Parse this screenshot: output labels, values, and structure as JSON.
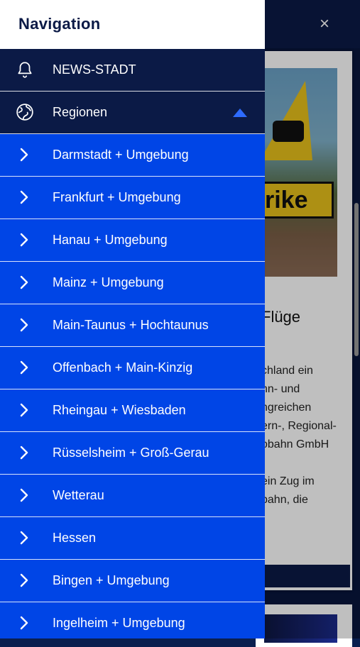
{
  "drawer": {
    "title": "Navigation",
    "top_items": [
      {
        "label": "NEWS-STADT",
        "icon": "bell-icon"
      },
      {
        "label": "Regionen",
        "icon": "globe-icon",
        "expanded": true
      }
    ],
    "regions": [
      "Darmstadt + Umgebung",
      "Frankfurt + Umgebung",
      "Hanau + Umgebung",
      "Mainz + Umgebung",
      "Main-Taunus + Hochtaunus",
      "Offenbach + Main-Kinzig",
      "Rheingau + Wiesbaden",
      "Rüsselsheim + Groß-Gerau",
      "Wetterau",
      "Hessen",
      "Bingen + Umgebung",
      "Ingelheim + Umgebung"
    ]
  },
  "background": {
    "close_glyph": "×",
    "image_text": "rike",
    "article_title": "Flüge",
    "article_lines": [
      "chland ein",
      "hn- und",
      "ngreichen",
      "ern-, Regional-",
      "obahn GmbH",
      "",
      "ein Zug im",
      "bahn, die"
    ]
  },
  "colors": {
    "drawer_blue": "#0045e6",
    "navy": "#0b1a46",
    "expand_arrow": "#2d6bff"
  }
}
